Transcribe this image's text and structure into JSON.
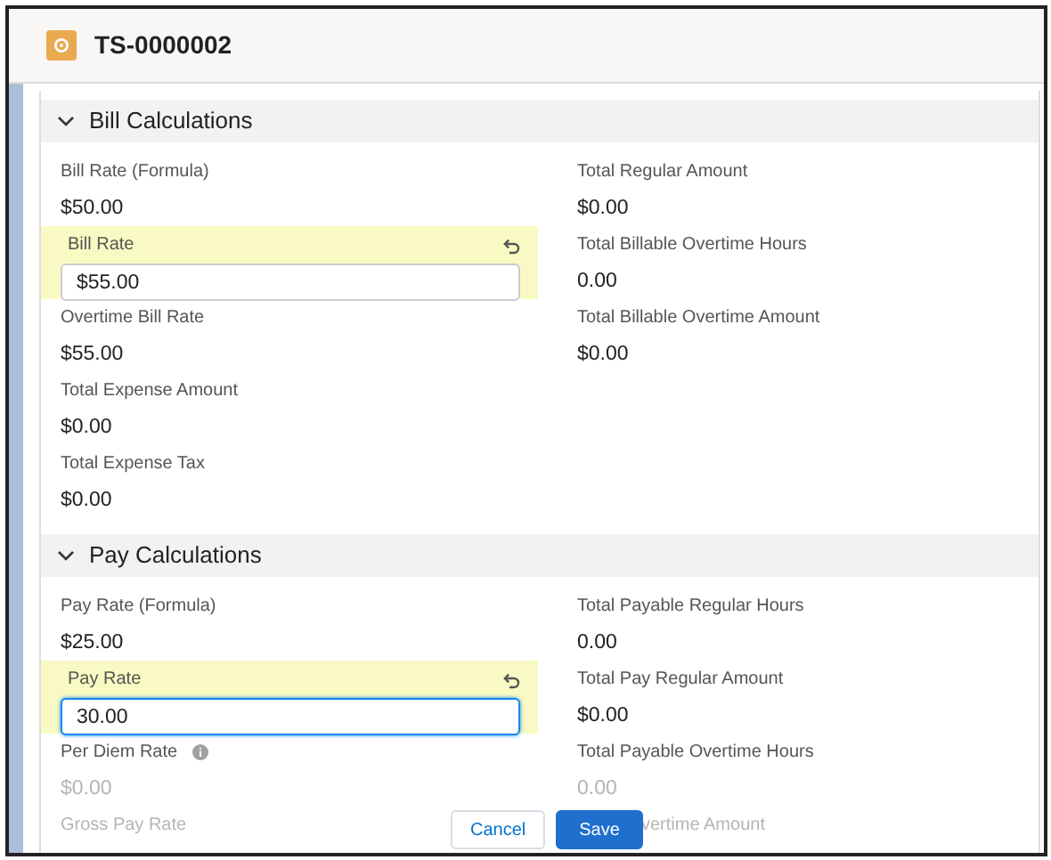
{
  "header": {
    "title": "TS-0000002"
  },
  "sections": [
    {
      "title": "Bill Calculations",
      "expanded": true,
      "left": [
        {
          "kind": "output",
          "label": "Bill Rate (Formula)",
          "value": "$50.00"
        },
        {
          "kind": "input",
          "label": "Bill Rate",
          "value": "$55.00",
          "focused": false
        },
        {
          "kind": "output",
          "label": "Overtime Bill Rate",
          "value": "$55.00"
        },
        {
          "kind": "output",
          "label": "Total Expense Amount",
          "value": "$0.00"
        },
        {
          "kind": "output",
          "label": "Total Expense Tax",
          "value": "$0.00"
        }
      ],
      "right": [
        {
          "kind": "output",
          "label": "Total Regular Amount",
          "value": "$0.00"
        },
        {
          "kind": "output",
          "label": "Total Billable Overtime Hours",
          "value": "0.00"
        },
        {
          "kind": "output",
          "label": "Total Billable Overtime Amount",
          "value": "$0.00"
        }
      ]
    },
    {
      "title": "Pay Calculations",
      "expanded": true,
      "left": [
        {
          "kind": "output",
          "label": "Pay Rate (Formula)",
          "value": "$25.00"
        },
        {
          "kind": "input",
          "label": "Pay Rate",
          "value": "30.00",
          "focused": true
        },
        {
          "kind": "output",
          "label": "Per Diem Rate",
          "value": "$0.00",
          "help_icon": true,
          "value_faded": true
        },
        {
          "kind": "output",
          "label": "Gross Pay Rate",
          "label_faded": true
        }
      ],
      "right": [
        {
          "kind": "output",
          "label": "Total Payable Regular Hours",
          "value": "0.00"
        },
        {
          "kind": "output",
          "label": "Total Pay Regular Amount",
          "value": "$0.00"
        },
        {
          "kind": "output",
          "label": "Total Payable Overtime Hours",
          "value": "0.00",
          "value_faded": true
        },
        {
          "kind": "output",
          "label": "vertime Amount",
          "label_faded": true,
          "behind_footer": true
        }
      ]
    }
  ],
  "footer": {
    "cancel": "Cancel",
    "save": "Save"
  }
}
